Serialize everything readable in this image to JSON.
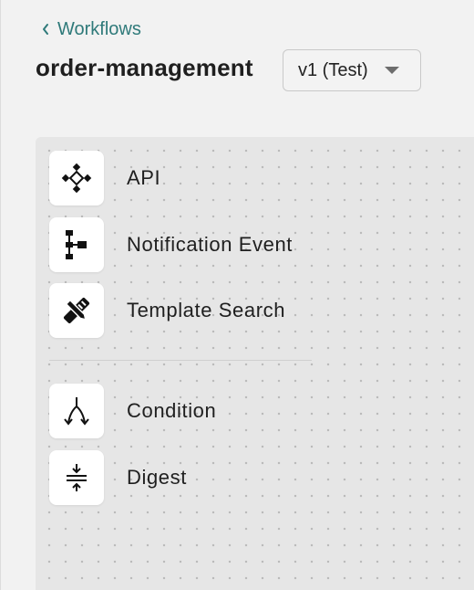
{
  "header": {
    "back_link": "Workflows",
    "title": "order-management",
    "version_select": {
      "selected": "v1 (Test)"
    }
  },
  "palette": {
    "items": [
      {
        "label": "API",
        "icon": "api-icon"
      },
      {
        "label": "Notification Event",
        "icon": "notification-event-icon"
      },
      {
        "label": "Template Search",
        "icon": "template-search-icon"
      },
      {
        "label": "Condition",
        "icon": "condition-icon"
      },
      {
        "label": "Digest",
        "icon": "digest-icon"
      }
    ]
  },
  "colors": {
    "link": "#2f7a7a",
    "canvas_bg": "#e6e6e6",
    "page_bg": "#f2f2f2"
  }
}
